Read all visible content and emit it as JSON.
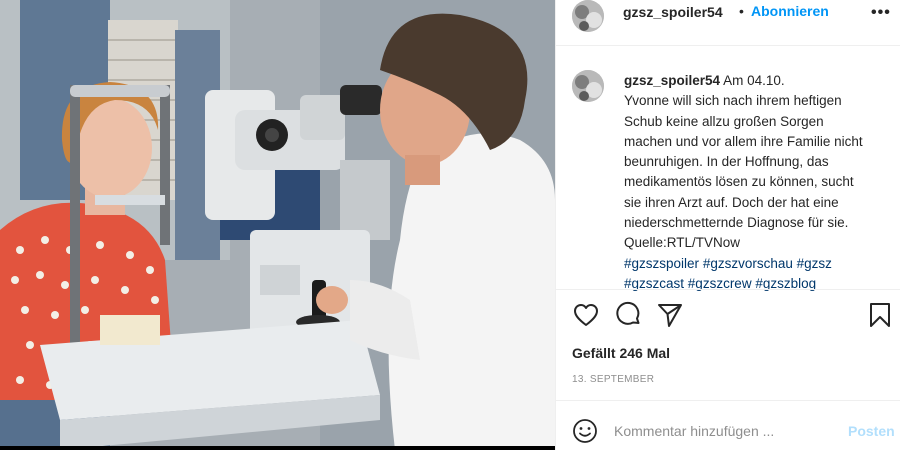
{
  "photo": {
    "alt": ""
  },
  "header": {
    "username": "gzsz_spoiler54",
    "separator": "•",
    "follow_label": "Abonnieren",
    "more_label": "•••"
  },
  "caption": {
    "username": "gzsz_spoiler54",
    "date": "Am 04.10.",
    "body_lines": [
      "Yvonne will sich nach ihrem heftigen",
      "Schub keine allzu großen Sorgen",
      "machen und vor allem ihre Familie nicht",
      "beunruhigen. In der Hoffnung, das",
      "medikamentös lösen zu können, sucht",
      "sie ihren Arzt auf. Doch der hat eine",
      "niederschmetternde Diagnose für sie.",
      "Quelle:RTL/TVNow"
    ],
    "hashtag_lines": [
      [
        "#gzszspoiler",
        "#gzszvorschau",
        "#gzsz"
      ],
      [
        "#gzszcast",
        "#gzszcrew",
        "#gzszblog"
      ]
    ]
  },
  "actions": {
    "like_icon": "heart-icon",
    "comment_icon": "speech-bubble-icon",
    "share_icon": "paper-plane-icon",
    "save_icon": "bookmark-icon"
  },
  "likes_text": "Gefällt 246 Mal",
  "post_date": "13. SEPTEMBER",
  "add_comment": {
    "placeholder": "Kommentar hinzufügen ...",
    "post_label": "Posten",
    "emoji_icon": "smiley-icon"
  },
  "colors": {
    "link_blue": "#0095f6",
    "hashtag_blue": "#00376b",
    "post_disabled": "#b2dffc",
    "muted_gray": "#8e8e8e"
  }
}
